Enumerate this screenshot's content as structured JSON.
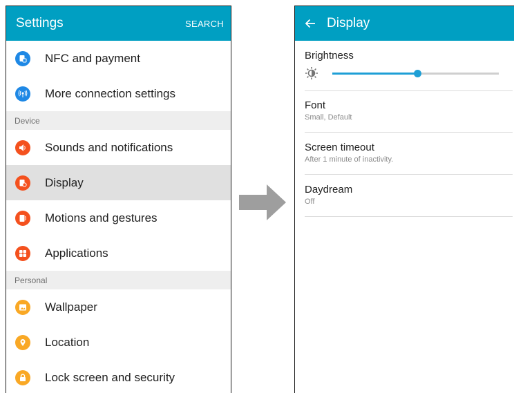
{
  "left_screen": {
    "header": {
      "title": "Settings",
      "search_label": "SEARCH"
    },
    "items": [
      {
        "label": "NFC and payment",
        "icon": "nfc-icon",
        "color": "#1e88e5"
      },
      {
        "label": "More connection settings",
        "icon": "antenna-icon",
        "color": "#1e88e5"
      }
    ],
    "sections": [
      {
        "header": "Device",
        "items": [
          {
            "label": "Sounds and notifications",
            "icon": "volume-icon",
            "color": "#f4511e"
          },
          {
            "label": "Display",
            "icon": "display-icon",
            "color": "#f4511e",
            "selected": true
          },
          {
            "label": "Motions and gestures",
            "icon": "motions-icon",
            "color": "#f4511e"
          },
          {
            "label": "Applications",
            "icon": "apps-grid-icon",
            "color": "#f4511e"
          }
        ]
      },
      {
        "header": "Personal",
        "items": [
          {
            "label": "Wallpaper",
            "icon": "wallpaper-icon",
            "color": "#f9a825"
          },
          {
            "label": "Location",
            "icon": "location-pin-icon",
            "color": "#f9a825"
          },
          {
            "label": "Lock screen and security",
            "icon": "lock-icon",
            "color": "#f9a825"
          }
        ]
      }
    ]
  },
  "right_screen": {
    "header": {
      "title": "Display",
      "back_icon": "back-arrow-icon"
    },
    "brightness": {
      "label": "Brightness",
      "icon": "brightness-sun-icon",
      "level_fraction": 0.51
    },
    "settings": [
      {
        "title": "Font",
        "subtitle": "Small, Default"
      },
      {
        "title": "Screen timeout",
        "subtitle": "After 1 minute of inactivity."
      },
      {
        "title": "Daydream",
        "subtitle": "Off"
      }
    ]
  },
  "transition_arrow": {
    "icon": "right-arrow-icon",
    "color": "#9e9e9e"
  },
  "colors": {
    "app_bar": "#009fc2",
    "accent": "#1e9fd6"
  }
}
